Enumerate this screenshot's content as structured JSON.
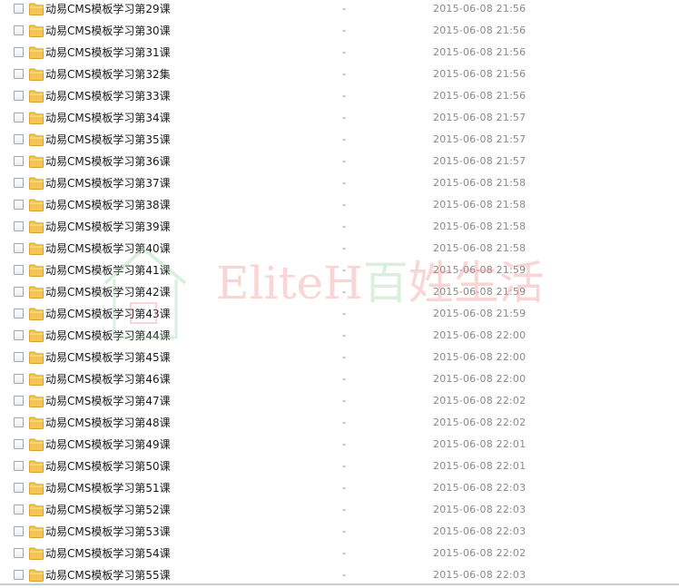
{
  "rows": [
    {
      "name": "动易CMS模板学习第29课",
      "size": "-",
      "time": "2015-06-08 21:56"
    },
    {
      "name": "动易CMS模板学习第30课",
      "size": "-",
      "time": "2015-06-08 21:56"
    },
    {
      "name": "动易CMS模板学习第31课",
      "size": "-",
      "time": "2015-06-08 21:56"
    },
    {
      "name": "动易CMS模板学习第32集",
      "size": "-",
      "time": "2015-06-08 21:56"
    },
    {
      "name": "动易CMS模板学习第33课",
      "size": "-",
      "time": "2015-06-08 21:56"
    },
    {
      "name": "动易CMS模板学习第34课",
      "size": "-",
      "time": "2015-06-08 21:57"
    },
    {
      "name": "动易CMS模板学习第35课",
      "size": "-",
      "time": "2015-06-08 21:57"
    },
    {
      "name": "动易CMS模板学习第36课",
      "size": "-",
      "time": "2015-06-08 21:57"
    },
    {
      "name": "动易CMS模板学习第37课",
      "size": "-",
      "time": "2015-06-08 21:58"
    },
    {
      "name": "动易CMS模板学习第38课",
      "size": "-",
      "time": "2015-06-08 21:58"
    },
    {
      "name": "动易CMS模板学习第39课",
      "size": "-",
      "time": "2015-06-08 21:58"
    },
    {
      "name": "动易CMS模板学习第40课",
      "size": "-",
      "time": "2015-06-08 21:58"
    },
    {
      "name": "动易CMS模板学习第41课",
      "size": "-",
      "time": "2015-06-08 21:59"
    },
    {
      "name": "动易CMS模板学习第42课",
      "size": "-",
      "time": "2015-06-08 21:59"
    },
    {
      "name": "动易CMS模板学习第43课",
      "size": "-",
      "time": "2015-06-08 21:59"
    },
    {
      "name": "动易CMS模板学习第44课",
      "size": "-",
      "time": "2015-06-08 22:00"
    },
    {
      "name": "动易CMS模板学习第45课",
      "size": "-",
      "time": "2015-06-08 22:00"
    },
    {
      "name": "动易CMS模板学习第46课",
      "size": "-",
      "time": "2015-06-08 22:00"
    },
    {
      "name": "动易CMS模板学习第47课",
      "size": "-",
      "time": "2015-06-08 22:02"
    },
    {
      "name": "动易CMS模板学习第48课",
      "size": "-",
      "time": "2015-06-08 22:02"
    },
    {
      "name": "动易CMS模板学习第49课",
      "size": "-",
      "time": "2015-06-08 22:01"
    },
    {
      "name": "动易CMS模板学习第50课",
      "size": "-",
      "time": "2015-06-08 22:01"
    },
    {
      "name": "动易CMS模板学习第51课",
      "size": "-",
      "time": "2015-06-08 22:03"
    },
    {
      "name": "动易CMS模板学习第52课",
      "size": "-",
      "time": "2015-06-08 22:03"
    },
    {
      "name": "动易CMS模板学习第53课",
      "size": "-",
      "time": "2015-06-08 22:03"
    },
    {
      "name": "动易CMS模板学习第54课",
      "size": "-",
      "time": "2015-06-08 22:02"
    },
    {
      "name": "动易CMS模板学习第55课",
      "size": "-",
      "time": "2015-06-08 22:03"
    }
  ],
  "watermark": {
    "latin": "EliteH",
    "cjk_green": "百",
    "cjk_red": "姓生活"
  },
  "colors": {
    "folder": "#f5c451",
    "folder_dark": "#d9a22a"
  }
}
